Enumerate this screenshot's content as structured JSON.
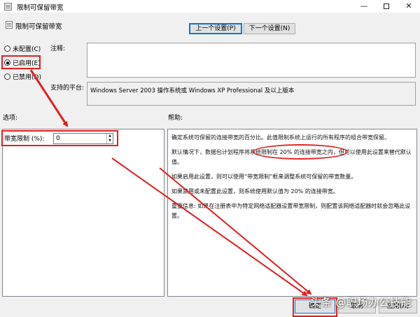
{
  "window": {
    "title": "限制可保留带宽",
    "minimize_glyph": "—",
    "close_glyph": "✕"
  },
  "header": {
    "policy_title": "限制可保留带宽",
    "prev_label": "上一个设置(P)",
    "next_label": "下一个设置(N)"
  },
  "state_options": [
    {
      "label": "未配置(C)",
      "checked": false
    },
    {
      "label": "已启用(E)",
      "checked": true
    },
    {
      "label": "已禁用(D)",
      "checked": false
    }
  ],
  "comment": {
    "label": "注释:",
    "value": ""
  },
  "platform": {
    "label": "支持的平台:",
    "value": "Windows Server 2003 操作系统或 Windows XP Professional 及以上版本"
  },
  "options": {
    "section_label": "选项:",
    "bandwidth_label": "带宽限制 (%):",
    "bandwidth_value": "0",
    "spin_up": "▲",
    "spin_down": "▼"
  },
  "help": {
    "section_label": "帮助:",
    "paragraphs": [
      "确定系统可保留的连接带宽的百分比。此值限制系统上运行的所有程序的组合带宽保留。",
      "默认情况下，数据包计划程序将系统限制在 20% 的连接带宽之内，但可以使用此设置来替代默认值。",
      "如果启用此设置，则可以使用“带宽限制”框来调整系统可保留的带宽数量。",
      "如果禁用或未配置此设置，则系统使用默认值为 20% 的连接带宽。",
      "重要信息: 如果在注册表中为特定网络适配器设置带宽限制，则配置该网络适配器时就会忽略此设置。"
    ]
  },
  "buttons": {
    "ok": "确定",
    "cancel": "取消",
    "apply": "应用(A)"
  },
  "watermark": "头条 @职场办公技能",
  "colors": {
    "annotation": "#e02020",
    "window_bg": "#f0f0f0",
    "focus_border": "#0078d7"
  }
}
